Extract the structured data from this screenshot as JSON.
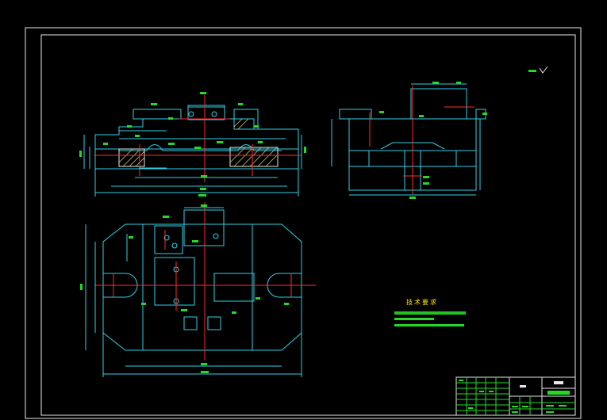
{
  "drawing": {
    "roughness_symbol": "其余 ▽",
    "tech_requirements_title": "技术要求",
    "tech_requirements_lines": 2,
    "colors": {
      "background": "#000000",
      "frame": "#e8e8e8",
      "outline": "#2fd0e8",
      "centerline": "#ff2a2a",
      "annotation": "#27d827",
      "note": "#ffe600",
      "hatch": "#d4c46a"
    },
    "views": [
      "front-view",
      "side-view",
      "top-view"
    ]
  }
}
